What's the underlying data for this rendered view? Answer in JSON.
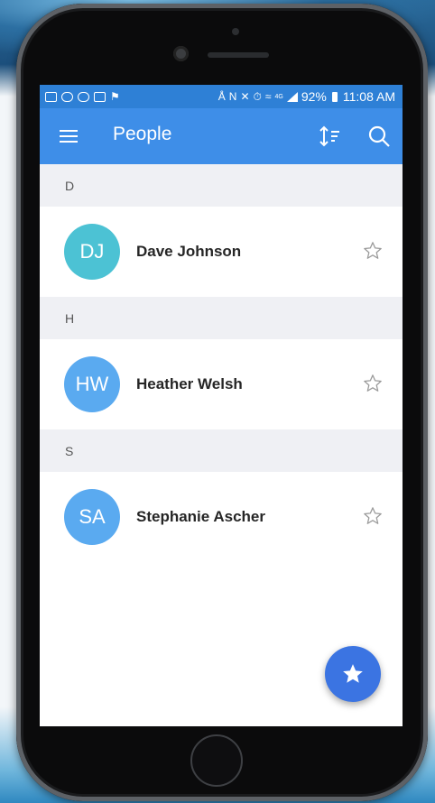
{
  "statusbar": {
    "battery": "92%",
    "time": "11:08 AM",
    "network": "4G"
  },
  "appbar": {
    "title": "People",
    "icons": [
      "menu-icon",
      "sort-icon",
      "search-icon"
    ]
  },
  "sections": [
    {
      "letter": "D",
      "contacts": [
        {
          "initials": "DJ",
          "name": "Dave Johnson",
          "color": "#4cc2d4",
          "favorite": false
        }
      ]
    },
    {
      "letter": "H",
      "contacts": [
        {
          "initials": "HW",
          "name": "Heather Welsh",
          "color": "#5aaaf0",
          "favorite": false
        }
      ]
    },
    {
      "letter": "S",
      "contacts": [
        {
          "initials": "SA",
          "name": "Stephanie Ascher",
          "color": "#5aaaf0",
          "favorite": false
        }
      ]
    }
  ],
  "fab": {
    "icon": "star-icon"
  },
  "colors": {
    "statusbar": "#2e80d6",
    "appbar": "#3e8ee8",
    "fab": "#3b74e2",
    "section_bg": "#eff0f4"
  }
}
